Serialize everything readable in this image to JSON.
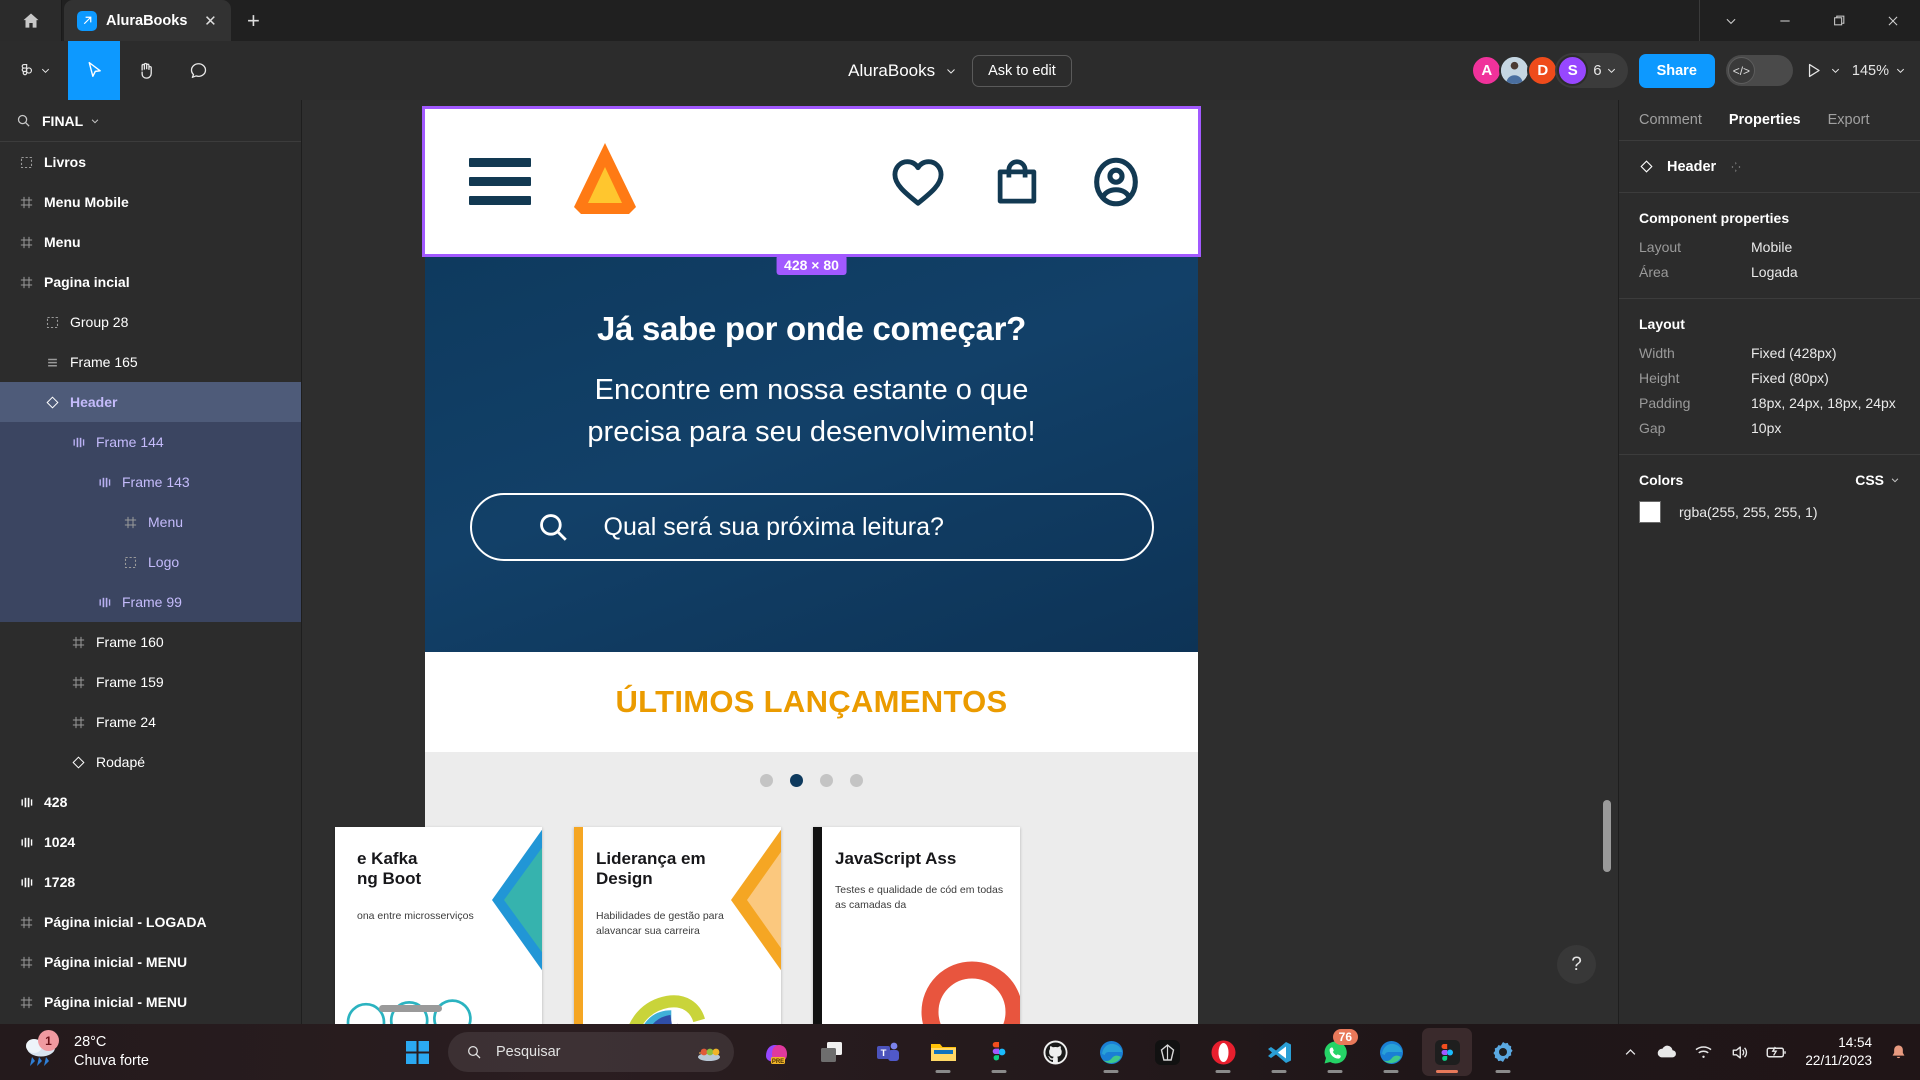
{
  "browser": {
    "home_icon": "home-icon",
    "tab": {
      "title": "AluraBooks",
      "favicon": "figma-icon",
      "close": "✕"
    },
    "new_tab": "+",
    "window_controls": [
      "chevron-down-icon",
      "minimize-icon",
      "restore-icon",
      "close-icon"
    ]
  },
  "figma_toolbar": {
    "menu_label": "figma-logo",
    "tools": [
      "move-tool",
      "hand-tool",
      "comment-tool"
    ],
    "file_title": "AluraBooks",
    "ask_to_edit": "Ask to edit",
    "avatars": [
      {
        "initial": "A",
        "color": "#f0329b"
      },
      {
        "initial": "",
        "color": "#9fb6c9"
      },
      {
        "initial": "D",
        "color": "#ef4b1b"
      },
      {
        "initial": "S",
        "color": "#9747ff"
      }
    ],
    "collaborator_count": "6",
    "share_label": "Share",
    "dev_mode_icon": "code-icon",
    "present_icon": "play-icon",
    "zoom_level": "145%"
  },
  "left_panel": {
    "search_icon": "search-icon",
    "page_name": "FINAL",
    "layers": [
      {
        "label": "Livros",
        "icon": "group-icon",
        "indent": 0,
        "state": "normal"
      },
      {
        "label": "Menu Mobile",
        "icon": "frame-icon",
        "indent": 0,
        "state": "normal"
      },
      {
        "label": "Menu",
        "icon": "frame-icon",
        "indent": 0,
        "state": "normal"
      },
      {
        "label": "Pagina incial",
        "icon": "frame-icon",
        "indent": 0,
        "state": "normal"
      },
      {
        "label": "Group 28",
        "icon": "group-icon",
        "indent": 1,
        "state": "normal"
      },
      {
        "label": "Frame 165",
        "icon": "autolayout-v-icon",
        "indent": 1,
        "state": "normal"
      },
      {
        "label": "Header",
        "icon": "component-icon",
        "indent": 1,
        "state": "selected"
      },
      {
        "label": "Frame 144",
        "icon": "autolayout-h-icon",
        "indent": 2,
        "state": "selected-child"
      },
      {
        "label": "Frame 143",
        "icon": "autolayout-h-icon",
        "indent": 3,
        "state": "selected-child"
      },
      {
        "label": "Menu",
        "icon": "frame-icon",
        "indent": 4,
        "state": "selected-child"
      },
      {
        "label": "Logo",
        "icon": "group-icon",
        "indent": 4,
        "state": "selected-child"
      },
      {
        "label": "Frame 99",
        "icon": "autolayout-h-icon",
        "indent": 3,
        "state": "selected-child"
      },
      {
        "label": "Frame 160",
        "icon": "frame-icon",
        "indent": 2,
        "state": "normal"
      },
      {
        "label": "Frame 159",
        "icon": "frame-icon",
        "indent": 2,
        "state": "normal"
      },
      {
        "label": "Frame 24",
        "icon": "frame-icon",
        "indent": 2,
        "state": "normal"
      },
      {
        "label": "Rodapé",
        "icon": "component-icon",
        "indent": 2,
        "state": "normal"
      },
      {
        "label": "428",
        "icon": "autolayout-h-icon",
        "indent": 0,
        "state": "normal"
      },
      {
        "label": "1024",
        "icon": "autolayout-h-icon",
        "indent": 0,
        "state": "normal"
      },
      {
        "label": "1728",
        "icon": "autolayout-h-icon",
        "indent": 0,
        "state": "normal"
      },
      {
        "label": "Página inicial - LOGADA",
        "icon": "frame-icon",
        "indent": 0,
        "state": "normal"
      },
      {
        "label": "Página inicial - MENU",
        "icon": "frame-icon",
        "indent": 0,
        "state": "normal"
      },
      {
        "label": "Página inicial - MENU",
        "icon": "frame-icon",
        "indent": 0,
        "state": "normal"
      }
    ]
  },
  "right_panel": {
    "tabs": [
      {
        "label": "Comment",
        "active": false
      },
      {
        "label": "Properties",
        "active": true
      },
      {
        "label": "Export",
        "active": false
      }
    ],
    "selection_name": "Header",
    "selection_icon": "component-icon",
    "swap_icon": "swap-instance-icon",
    "component_properties": {
      "title": "Component properties",
      "rows": [
        {
          "key": "Layout",
          "value": "Mobile"
        },
        {
          "key": "Área",
          "value": "Logada"
        }
      ]
    },
    "layout": {
      "title": "Layout",
      "rows": [
        {
          "key": "Width",
          "value": "Fixed (428px)"
        },
        {
          "key": "Height",
          "value": "Fixed (80px)"
        },
        {
          "key": "Padding",
          "value": "18px, 24px, 18px, 24px"
        },
        {
          "key": "Gap",
          "value": "10px"
        }
      ]
    },
    "colors": {
      "title": "Colors",
      "format_label": "CSS",
      "swatches": [
        {
          "hex": "#ffffff",
          "value": "rgba(255, 255, 255, 1)"
        }
      ]
    }
  },
  "canvas": {
    "selection_size_badge": "428 × 80",
    "selection_color": "#a259ff",
    "artboard": {
      "header": {
        "menu_icon": "hamburger-menu-icon",
        "logo_icon": "alura-logo-icon",
        "icons": [
          "heart-icon",
          "shopping-bag-icon",
          "user-account-icon"
        ],
        "brand_navy": "#123952",
        "brand_orange": "#ff7a14",
        "brand_yellow": "#ffc62e"
      },
      "hero": {
        "heading": "Já sabe por onde começar?",
        "subheading_line1": "Encontre em nossa estante o que",
        "subheading_line2": "precisa para seu desenvolvimento!",
        "search_placeholder": "Qual será sua próxima leitura?",
        "search_icon": "search-icon",
        "background": "#0e3a5e"
      },
      "section": {
        "title": "ÚLTIMOS LANÇAMENTOS",
        "title_color": "#eb9b00"
      },
      "carousel": {
        "dot_count": 4,
        "active_dot_index": 1,
        "books": [
          {
            "title_line1": "e Kafka",
            "title_line2": "ng Boot",
            "subtitle": "ona entre microsserviços",
            "spine": "#ffffff",
            "accent": "#2196d6"
          },
          {
            "title_line1": "Liderança em",
            "title_line2": "Design",
            "subtitle": "Habilidades de gestão para alavancar sua carreira",
            "spine": "#f5a623",
            "accent": "#f5a623"
          },
          {
            "title_line1": "JavaScript Ass",
            "title_line2": "",
            "subtitle": "Testes e qualidade de cód em todas as camadas da",
            "spine": "#111111",
            "accent": "#e8553e"
          }
        ]
      }
    },
    "help_label": "?"
  },
  "taskbar": {
    "weather": {
      "temperature": "28°C",
      "condition": "Chuva forte",
      "badge": "1",
      "icon": "rain-cloud-icon"
    },
    "start_icon": "windows-start-icon",
    "search_placeholder": "Pesquisar",
    "search_icon": "search-icon",
    "search_emoji": "kebab-skewer-icon",
    "apps": [
      {
        "name": "copilot-pro-icon",
        "running": false,
        "active": false,
        "badge": ""
      },
      {
        "name": "task-view-icon",
        "running": false,
        "active": false,
        "badge": ""
      },
      {
        "name": "microsoft-teams-icon",
        "running": false,
        "active": false,
        "badge": ""
      },
      {
        "name": "file-explorer-icon",
        "running": true,
        "active": false,
        "badge": ""
      },
      {
        "name": "figma-desktop-icon",
        "running": true,
        "active": false,
        "badge": ""
      },
      {
        "name": "github-icon",
        "running": false,
        "active": false,
        "badge": ""
      },
      {
        "name": "microsoft-edge-icon",
        "running": true,
        "active": false,
        "badge": ""
      },
      {
        "name": "obsidian-icon",
        "running": false,
        "active": false,
        "badge": ""
      },
      {
        "name": "opera-icon",
        "running": true,
        "active": false,
        "badge": ""
      },
      {
        "name": "vs-code-icon",
        "running": true,
        "active": false,
        "badge": ""
      },
      {
        "name": "whatsapp-icon",
        "running": true,
        "active": false,
        "badge": "76"
      },
      {
        "name": "microsoft-edge-icon",
        "running": true,
        "active": false,
        "badge": ""
      },
      {
        "name": "figma-app-icon",
        "running": true,
        "active": true,
        "badge": ""
      },
      {
        "name": "settings-icon",
        "running": true,
        "active": false,
        "badge": ""
      }
    ],
    "tray": {
      "overflow_icon": "chevron-up-icon",
      "onedrive_icon": "onedrive-icon",
      "wifi_icon": "wifi-icon",
      "volume_icon": "volume-icon",
      "battery_icon": "battery-charging-icon",
      "time": "14:54",
      "date": "22/11/2023",
      "notification_icon": "bell-icon"
    }
  }
}
